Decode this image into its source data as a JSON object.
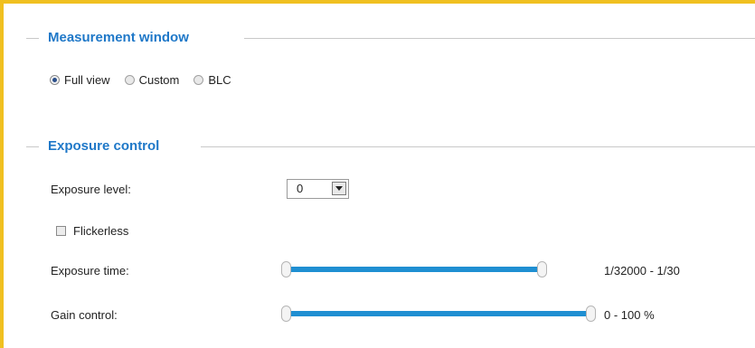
{
  "measurement_window": {
    "title": "Measurement window",
    "options": [
      {
        "label": "Full view",
        "checked": true
      },
      {
        "label": "Custom",
        "checked": false
      },
      {
        "label": "BLC",
        "checked": false
      }
    ]
  },
  "exposure_control": {
    "title": "Exposure control",
    "exposure_level": {
      "label": "Exposure level:",
      "value": "0"
    },
    "flickerless": {
      "label": "Flickerless",
      "checked": false
    },
    "exposure_time": {
      "label": "Exposure time:",
      "range": "1/32000 - 1/30"
    },
    "gain_control": {
      "label": "Gain control:",
      "range": "0 - 100 %"
    }
  },
  "colors": {
    "accent": "#1f78c8",
    "slider": "#1f8fd2",
    "frame": "#f0c020"
  }
}
